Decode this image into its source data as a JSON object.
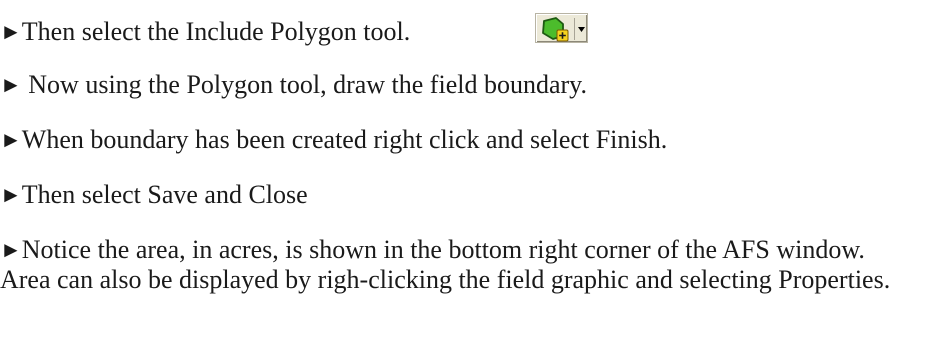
{
  "bullet_glyph": "►",
  "instructions": [
    {
      "text": "Then select the Include Polygon tool."
    },
    {
      "text": " Now using the Polygon tool, draw the field boundary."
    },
    {
      "text": "When boundary has been created right click and select Finish."
    },
    {
      "text": "Then select Save and Close"
    },
    {
      "text": "Notice the area, in acres, is shown in the bottom right corner of the AFS window. Area can also be displayed by righ-clicking the field graphic and selecting Properties."
    }
  ],
  "tool_icon": {
    "name": "include-polygon-tool-icon",
    "colors": {
      "polygon_fill": "#4cbc2c",
      "polygon_stroke": "#1e5a12",
      "plus_fill": "#f5d21e",
      "plus_stroke": "#7a5a00",
      "arrow": "#000000"
    }
  }
}
